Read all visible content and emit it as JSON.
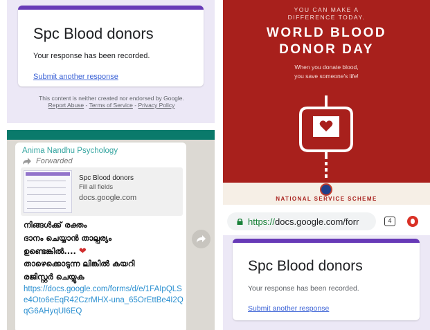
{
  "top_left": {
    "form_title": "Spc Blood donors",
    "recorded_text": "Your response has been recorded.",
    "submit_another": "Submit another response",
    "footer": {
      "disclaimer": "This content is neither created nor endorsed by Google.",
      "report_abuse": "Report Abuse",
      "sep1": " - ",
      "terms": "Terms of Service",
      "sep2": " - ",
      "privacy": "Privacy Policy"
    }
  },
  "chat": {
    "sender": "Anima Nandhu Psychology",
    "forwarded": "Forwarded",
    "preview": {
      "title": "Spc Blood donors",
      "subtitle": "Fill all fields",
      "domain": "docs.google.com"
    },
    "message_lines": [
      "നിങ്ങൾക്ക് രക്തം",
      "ദാനം ചെയ്യാൻ താല്പര്യം",
      "ഉണ്ടെങ്കിൽ....",
      "താഴെക്കൊടുന്ന ലിങ്കിൽ കയറി",
      "രജിസ്റ്റർ ചെയ്യുക"
    ],
    "heart": "❤",
    "link": "https://docs.google.com/forms/d/e/1FAIpQLSe4Oto6eEqR42CzrMHX-una_65OrEttBe4I2QqG6AHyqUI6EQ"
  },
  "poster": {
    "tagline": "YOU CAN MAKE A DIFFERENCE TODAY.",
    "headline_line1": "WORLD BLOOD",
    "headline_line2": "DONOR DAY",
    "sub_line1": "When you donate blood,",
    "sub_line2": "you save someone's life!",
    "organization": "NATIONAL SERVICE SCHEME",
    "colors": {
      "background": "#a8201c",
      "text": "#ffffff"
    }
  },
  "browser": {
    "url_protocol": "https://",
    "url_rest": "docs.google.com/forr",
    "tab_count": "4",
    "form_title": "Spc Blood donors",
    "recorded_text": "Your response has been recorded.",
    "submit_another": "Submit another response"
  },
  "colors": {
    "form_accent": "#673ab7",
    "form_background": "#ece8f6",
    "whatsapp_green": "#0a7a6b",
    "link_blue": "#2a8fd0"
  }
}
